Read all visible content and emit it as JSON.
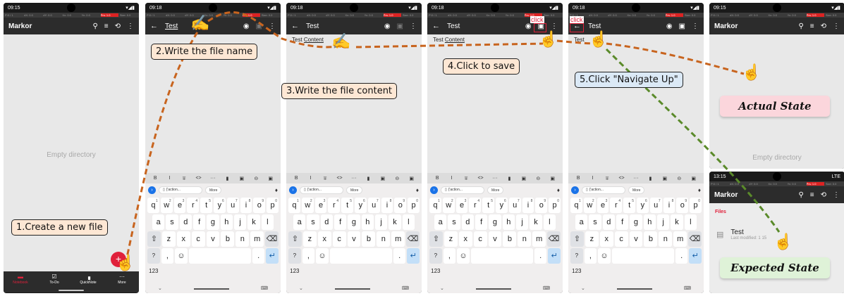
{
  "colors": {
    "accent": "#e0213b",
    "app_bar": "#2c2c2c",
    "body_bg": "#e8e8e8",
    "path_orange": "#c8641e",
    "path_green": "#5a8a2a"
  },
  "debug_bar": [
    "P:0 / 1",
    "dX: 0.0",
    "dY: 0.0",
    "Xv: 0.0",
    "Yv: 0.0",
    "Prs: 1.0",
    "Size: 0.0"
  ],
  "screens": {
    "s1": {
      "time": "09:15",
      "app_title": "Markor",
      "empty_text": "Empty directory",
      "fab_label": "+",
      "nav": [
        {
          "label": "Notebook",
          "icon": "folder-icon"
        },
        {
          "label": "To-Do",
          "icon": "checkbox-icon"
        },
        {
          "label": "QuickNote",
          "icon": "note-icon"
        },
        {
          "label": "More",
          "icon": "more-icon"
        }
      ]
    },
    "s2": {
      "time": "09:18",
      "title": "Test"
    },
    "s3": {
      "time": "09:18",
      "title": "Test",
      "body_prefix": "Test ",
      "body_word": "Content"
    },
    "s4": {
      "time": "09:18",
      "title": "Test",
      "body_prefix": "Test ",
      "body_word": "Content",
      "click_label": "click"
    },
    "s5": {
      "time": "09:18",
      "title": "Test",
      "body_prefix": "Test",
      "click_label": "click"
    },
    "s6": {
      "time": "09:15",
      "app_title": "Markor",
      "empty_text": "Empty directory"
    },
    "s7": {
      "time": "13:15",
      "network": "LTE",
      "app_title": "Markor",
      "files_label": "Files",
      "file_name": "Test",
      "file_meta": "Last modified: 1",
      "file_meta_tail": "15"
    }
  },
  "keyboard": {
    "suggest_chip": "{'action...",
    "more_chip": "More",
    "row1": [
      {
        "k": "q",
        "n": "1"
      },
      {
        "k": "w",
        "n": "2"
      },
      {
        "k": "e",
        "n": "3"
      },
      {
        "k": "r",
        "n": "4"
      },
      {
        "k": "t",
        "n": "5"
      },
      {
        "k": "y",
        "n": "6"
      },
      {
        "k": "u",
        "n": "7"
      },
      {
        "k": "i",
        "n": "8"
      },
      {
        "k": "o",
        "n": "9"
      },
      {
        "k": "p",
        "n": "0"
      }
    ],
    "row2": [
      "a",
      "s",
      "d",
      "f",
      "g",
      "h",
      "j",
      "k",
      "l"
    ],
    "row3": [
      "z",
      "x",
      "c",
      "v",
      "b",
      "n",
      "m"
    ],
    "sym": "?123",
    "comma": ",",
    "emoji": "☺",
    "period": "."
  },
  "format_bar": [
    "B",
    "I",
    "∓",
    "<>",
    "···",
    "▮",
    "▣",
    "⊝",
    "▣"
  ],
  "callouts": {
    "step1": "1.Create a new file",
    "step2": "2.Write the file name",
    "step3": "3.Write the file content",
    "step4": "4.Click to save",
    "step5": "5.Click \"Navigate Up\""
  },
  "states": {
    "actual": "Actual State",
    "expected": "Expected State"
  }
}
